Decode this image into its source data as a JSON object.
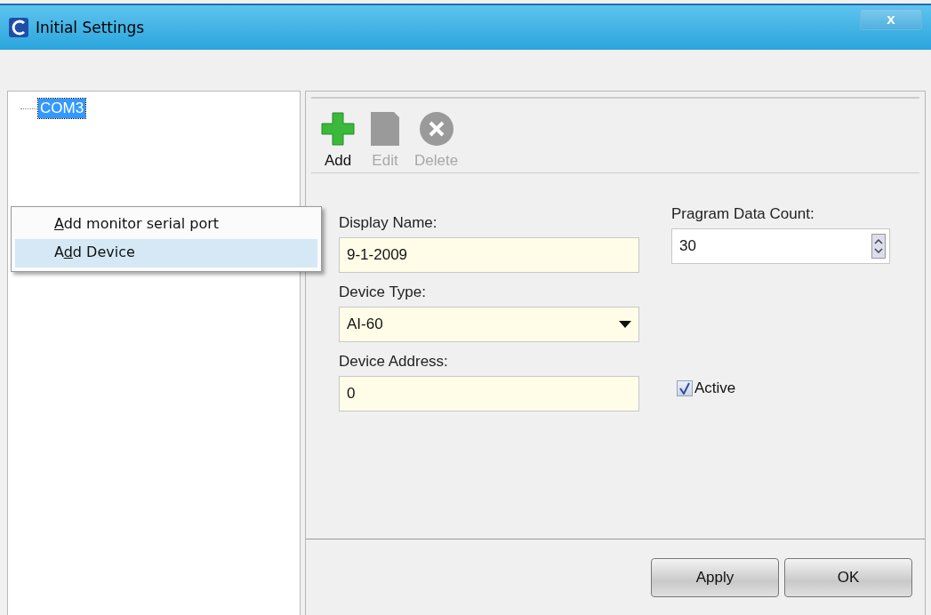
{
  "window": {
    "title": "Initial Settings",
    "close": "x"
  },
  "tree": {
    "items": [
      {
        "label": "COM3",
        "selected": true
      }
    ]
  },
  "context_menu": {
    "items": [
      {
        "parts": [
          {
            "text": "A",
            "underlined": true
          },
          {
            "text": "dd monitor serial port",
            "underlined": false
          }
        ],
        "selected": false
      },
      {
        "parts": [
          {
            "text": "A",
            "underlined": false
          },
          {
            "text": "d",
            "underlined": true
          },
          {
            "text": "d Device",
            "underlined": false
          }
        ],
        "selected": true
      }
    ]
  },
  "toolbar": [
    {
      "kind": "add",
      "label": "Add",
      "disabled": false
    },
    {
      "kind": "edit",
      "label": "Edit",
      "disabled": true
    },
    {
      "kind": "delete",
      "label": "Delete",
      "disabled": true
    }
  ],
  "form": {
    "display_name": {
      "label": "Display Name:",
      "value": "9-1-2009"
    },
    "device_type": {
      "label": "Device Type:",
      "value": "AI-60"
    },
    "device_address": {
      "label": "Device Address:",
      "value": "0"
    },
    "program_data_count": {
      "label": "Pragram Data Count:",
      "value": "30"
    },
    "active": {
      "label": "Active",
      "checked": true
    }
  },
  "buttons": [
    "Apply",
    "OK"
  ]
}
